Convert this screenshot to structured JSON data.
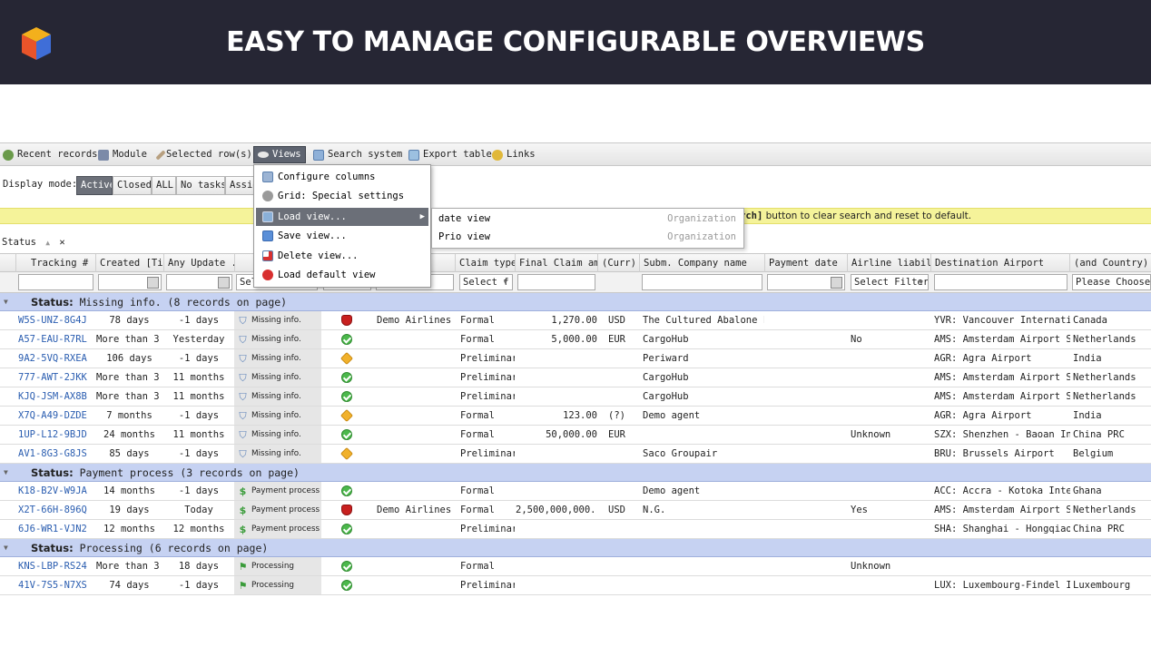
{
  "banner": {
    "title": "EASY TO MANAGE CONFIGURABLE OVERVIEWS"
  },
  "toolbar": {
    "recent_records": "Recent records",
    "module": "Module",
    "selected_rows": "Selected row(s)",
    "views": "Views",
    "search_system": "Search system",
    "export_table": "Export table",
    "links": "Links"
  },
  "display_mode": {
    "label": "Display mode:",
    "buttons": [
      "Active",
      "Closed",
      "ALL",
      "No tasks",
      "Assig"
    ],
    "selected": "Active"
  },
  "notice": {
    "bold": "rch]",
    "text": " button to clear search and reset to default."
  },
  "group_chip": {
    "label": "Status",
    "sort": "▲",
    "close": "✕"
  },
  "views_menu": {
    "items": [
      "Configure columns",
      "Grid: Special settings",
      "Load view...",
      "Save view...",
      "Delete view...",
      "Load default view"
    ],
    "hover_index": 2
  },
  "load_view_submenu": [
    {
      "name": "date view",
      "owner": "Organization"
    },
    {
      "name": "Prio view",
      "owner": "Organization"
    }
  ],
  "columns": [
    "Tracking #",
    "Created [Ti...",
    "Any Update ...",
    "",
    "",
    "",
    "Claim type",
    "Final Claim am...",
    "(Curr)",
    "Subm. Company name",
    "Payment date",
    "Airline liability",
    "Destination Airport",
    "(and Country)"
  ],
  "filters": {
    "status": "Sel",
    "claim_type": "Select f",
    "airline_liability": "Select Filter",
    "country": "Please Choose:"
  },
  "groups": [
    {
      "label": "Status:",
      "name": "Missing info. (8 records on page)",
      "rows": [
        {
          "tracking": "W5S-UNZ-8G4J",
          "created": "78 days",
          "update": "-1 days",
          "status": "Missing info.",
          "indicator": "stop",
          "airline": "Demo Airlines",
          "claim": "Formal",
          "amount": "1,270.00",
          "curr": "USD",
          "company": "The  Cultured Abalone F...",
          "payment": "",
          "liability": "",
          "dest": "YVR: Vancouver Internation...",
          "country": "Canada"
        },
        {
          "tracking": "A57-EAU-R7RL",
          "created": "More than 3 ...",
          "update": "Yesterday",
          "status": "Missing info.",
          "indicator": "ok",
          "airline": "",
          "claim": "Formal",
          "amount": "5,000.00",
          "curr": "EUR",
          "company": "CargoHub",
          "payment": "",
          "liability": "No",
          "dest": "AMS: Amsterdam Airport S...",
          "country": "Netherlands"
        },
        {
          "tracking": "9A2-5VQ-RXEA",
          "created": "106 days",
          "update": "-1 days",
          "status": "Missing info.",
          "indicator": "warn",
          "airline": "",
          "claim": "Preliminary",
          "amount": "",
          "curr": "",
          "company": "Periward",
          "payment": "",
          "liability": "",
          "dest": "AGR: Agra Airport",
          "country": "India"
        },
        {
          "tracking": "777-AWT-2JKK",
          "created": "More than 3 ...",
          "update": "11 months",
          "status": "Missing info.",
          "indicator": "ok",
          "airline": "",
          "claim": "Preliminary",
          "amount": "",
          "curr": "",
          "company": "CargoHub",
          "payment": "",
          "liability": "",
          "dest": "AMS: Amsterdam Airport S...",
          "country": "Netherlands"
        },
        {
          "tracking": "KJQ-JSM-AX8B",
          "created": "More than 3 ...",
          "update": "11 months",
          "status": "Missing info.",
          "indicator": "ok",
          "airline": "",
          "claim": "Preliminary",
          "amount": "",
          "curr": "",
          "company": "CargoHub",
          "payment": "",
          "liability": "",
          "dest": "AMS: Amsterdam Airport S...",
          "country": "Netherlands"
        },
        {
          "tracking": "X7Q-A49-DZDE",
          "created": "7 months",
          "update": "-1 days",
          "status": "Missing info.",
          "indicator": "warn",
          "airline": "",
          "claim": "Formal",
          "amount": "123.00",
          "curr": "(?)",
          "company": "Demo agent",
          "payment": "",
          "liability": "",
          "dest": "AGR: Agra Airport",
          "country": "India"
        },
        {
          "tracking": "1UP-L12-9BJD",
          "created": "24 months",
          "update": "11 months",
          "status": "Missing info.",
          "indicator": "ok",
          "airline": "",
          "claim": "Formal",
          "amount": "50,000.00",
          "curr": "EUR",
          "company": "",
          "payment": "",
          "liability": "Unknown",
          "dest": "SZX: Shenzhen - Baoan Int...",
          "country": "China PRC"
        },
        {
          "tracking": "AV1-8G3-G8JS",
          "created": "85 days",
          "update": "-1 days",
          "status": "Missing info.",
          "indicator": "warn",
          "airline": "",
          "claim": "Preliminary",
          "amount": "",
          "curr": "",
          "company": "Saco Groupair",
          "payment": "",
          "liability": "",
          "dest": "BRU: Brussels Airport",
          "country": "Belgium"
        }
      ]
    },
    {
      "label": "Status:",
      "name": "Payment process (3 records on page)",
      "rows": [
        {
          "tracking": "K18-B2V-W9JA",
          "created": "14 months",
          "update": "-1 days",
          "status": "Payment process",
          "indicator": "ok",
          "airline": "",
          "claim": "Formal",
          "amount": "",
          "curr": "",
          "company": "Demo agent",
          "payment": "",
          "liability": "",
          "dest": "ACC: Accra - Kotoka Intern...",
          "country": "Ghana"
        },
        {
          "tracking": "X2T-66H-896Q",
          "created": "19 days",
          "update": "Today",
          "status": "Payment process",
          "indicator": "stop",
          "airline": "Demo Airlines",
          "claim": "Formal",
          "amount": "2,500,000,000....",
          "curr": "USD",
          "company": "N.G.",
          "payment": "",
          "liability": "Yes",
          "dest": "AMS: Amsterdam Airport S...",
          "country": "Netherlands"
        },
        {
          "tracking": "6J6-WR1-VJN2",
          "created": "12 months",
          "update": "12 months",
          "status": "Payment process",
          "indicator": "ok",
          "airline": "",
          "claim": "Preliminary",
          "amount": "",
          "curr": "",
          "company": "",
          "payment": "",
          "liability": "",
          "dest": "SHA: Shanghai - Hongqiao ...",
          "country": "China PRC"
        }
      ]
    },
    {
      "label": "Status:",
      "name": "Processing (6 records on page)",
      "rows": [
        {
          "tracking": "KNS-LBP-RS24",
          "created": "More than 3 ...",
          "update": "18 days",
          "status": "Processing",
          "indicator": "ok",
          "airline": "",
          "claim": "Formal",
          "amount": "",
          "curr": "",
          "company": "",
          "payment": "",
          "liability": "Unknown",
          "dest": "",
          "country": ""
        },
        {
          "tracking": "41V-7S5-N7XS",
          "created": "74 days",
          "update": "-1 days",
          "status": "Processing",
          "indicator": "ok",
          "airline": "",
          "claim": "Preliminary",
          "amount": "",
          "curr": "",
          "company": "",
          "payment": "",
          "liability": "",
          "dest": "LUX: Luxembourg-Findel In...",
          "country": "Luxembourg"
        }
      ]
    }
  ],
  "colors": {
    "banner_bg": "#262634",
    "group_bg": "#c6d2f2",
    "link": "#2a5db0",
    "notice_bg": "#f5f39a"
  }
}
